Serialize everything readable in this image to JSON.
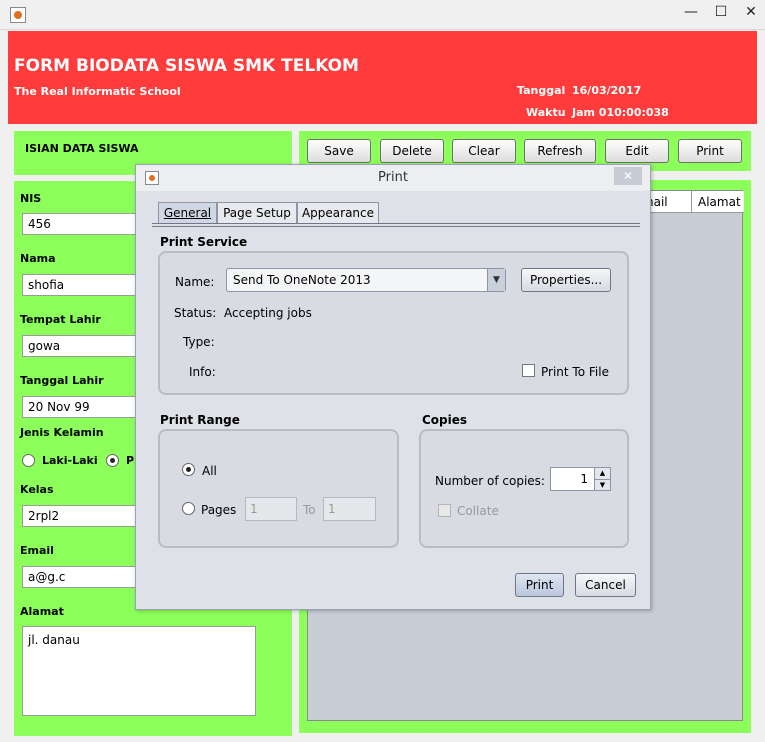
{
  "window": {
    "minimize_glyph": "—",
    "maximize_glyph": "☐",
    "close_glyph": "✕"
  },
  "header": {
    "title": "FORM BIODATA SISWA SMK TELKOM",
    "subtitle": "The Real Informatic School",
    "tanggal_label": "Tanggal",
    "tanggal_value": "16/03/2017",
    "waktu_label": "Waktu",
    "waktu_value": "Jam 010:00:038",
    "bg_color": "#ff3b3b"
  },
  "isian": {
    "label": "ISIAN DATA SISWA"
  },
  "form": {
    "nis_label": "NIS",
    "nis_value": "456",
    "nama_label": "Nama",
    "nama_value": "shofia",
    "tempat_label": "Tempat Lahir",
    "tempat_value": "gowa",
    "tanggal_label": "Tanggal Lahir",
    "tanggal_value": "20 Nov 99",
    "jk_label": "Jenis Kelamin",
    "jk_option1": "Laki-Laki",
    "jk_option2": "P",
    "kelas_label": "Kelas",
    "kelas_value": "2rpl2",
    "email_label": "Email",
    "email_value": "a@g.c",
    "alamat_label": "Alamat",
    "alamat_value": "jl. danau"
  },
  "toolbar": {
    "save": "Save",
    "delete": "Delete",
    "clear": "Clear",
    "refresh": "Refresh",
    "edit": "Edit",
    "print": "Print"
  },
  "table": {
    "col_email": "nail",
    "col_alamat": "Alamat"
  },
  "dialog": {
    "title": "Print",
    "close_glyph": "✕",
    "tabs": {
      "general": "General",
      "page_setup": "Page Setup",
      "appearance": "Appearance"
    },
    "print_service": {
      "title": "Print Service",
      "name_label": "Name:",
      "name_value": "Send To OneNote 2013",
      "properties": "Properties...",
      "status_label": "Status:",
      "status_value": "Accepting jobs",
      "type_label": "Type:",
      "info_label": "Info:",
      "print_to_file": "Print To File"
    },
    "print_range": {
      "title": "Print Range",
      "all": "All",
      "pages": "Pages",
      "from_value": "1",
      "to_label": "To",
      "to_value": "1"
    },
    "copies": {
      "title": "Copies",
      "number_label": "Number of copies:",
      "number_value": "1",
      "collate": "Collate"
    },
    "print_button": "Print",
    "cancel_button": "Cancel"
  }
}
